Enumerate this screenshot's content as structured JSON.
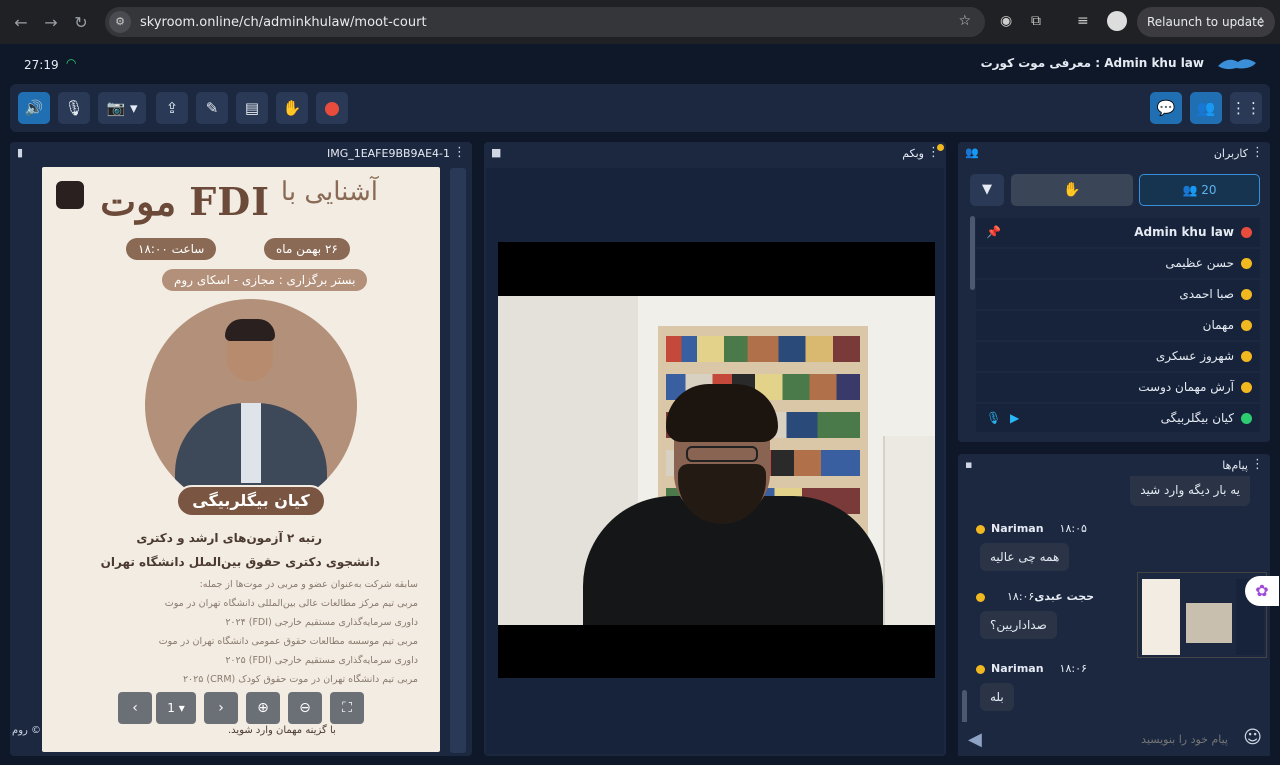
{
  "browser": {
    "url": "skyroom.online/ch/adminkhulaw/moot-court",
    "relaunch": "Relaunch to update"
  },
  "room": {
    "timer": "27:19",
    "title": "Admin khu law : معرفی موت کورت"
  },
  "presentation": {
    "filename": "IMG_1EAFE9BB9AE4-1",
    "poster": {
      "title_script": "آشنایی با",
      "title_main": "موت FDI",
      "date": "۲۶ بهمن ماه",
      "time": "ساعت ۱۸:۰۰",
      "venue": "بستر برگزاری : مجازی - اسکای روم",
      "speaker": "کیان بیگلربیگی",
      "line1": "رتبه ۲ آزمون‌های ارشد و دکتری",
      "line2": "دانشجوی دکتری حقوق بین‌الملل دانشگاه تهران",
      "bio": [
        "سابقه شرکت به‌عنوان عضو و مربی در موت‌ها از جمله:",
        "مربی تیم مرکز مطالعات عالی بین‌المللی دانشگاه تهران در موت",
        "داوری سرمایه‌گذاری مستقیم خارجی (FDI) ۲۰۲۴",
        "مربی تیم موسسه مطالعات حقوق عمومی دانشگاه تهران در موت",
        "داوری سرمایه‌گذاری مستقیم خارجی (FDI) ۲۰۲۵",
        "مربی تیم دانشگاه تهران در موت حقوق کودک (CRM) ۲۰۲۵"
      ],
      "footer": "با گزینه مهمان وارد شوید.",
      "cutoff": "روم ©"
    },
    "page": "1"
  },
  "webcam": {
    "title": "وبکم"
  },
  "users": {
    "title": "کاربران",
    "count": "20",
    "list": [
      {
        "name": "Admin khu law",
        "color": "#e74c3c"
      },
      {
        "name": "حسن عظیمی",
        "color": "#f1b820"
      },
      {
        "name": "صبا احمدی",
        "color": "#f1b820"
      },
      {
        "name": "مهمان",
        "color": "#f1b820"
      },
      {
        "name": "شهروز عسکری",
        "color": "#f1b820"
      },
      {
        "name": "آرش مهمان دوست",
        "color": "#f1b820"
      },
      {
        "name": "کیان بیگلربیگی",
        "color": "#2ecc71"
      }
    ]
  },
  "chat": {
    "title": "پیام‌ها",
    "messages": [
      {
        "text": "یه بار دیگه وارد شید"
      },
      {
        "user": "Nariman",
        "time": "۱۸:۰۵",
        "text": "همه چی عالیه"
      },
      {
        "user": "حجت عبدی",
        "time": "۱۸:۰۶",
        "text": "صداداریین؟"
      },
      {
        "user": "Nariman",
        "time": "۱۸:۰۶",
        "text": "بله"
      }
    ],
    "placeholder": "پیام خود را بنویسید"
  }
}
